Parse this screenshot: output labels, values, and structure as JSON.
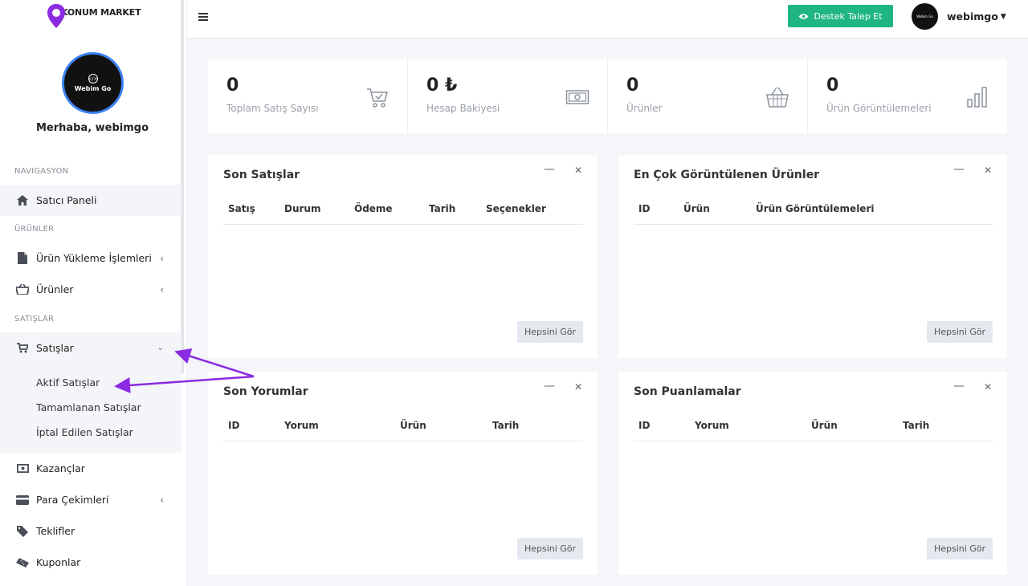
{
  "brand": {
    "name": "KONUM MARKET",
    "avatar_text": "Webim Go"
  },
  "sidebar": {
    "greeting": "Merhaba, webimgo",
    "sections": {
      "nav": "NAVIGASYON",
      "products": "ÜRÜNLER",
      "sales": "SATIŞLAR"
    },
    "items": {
      "dashboard": "Satıcı Paneli",
      "upload": "Ürün Yükleme İşlemleri",
      "products": "Ürünler",
      "sales": "Satışlar",
      "earnings": "Kazançlar",
      "withdrawals": "Para Çekimleri",
      "offers": "Teklifler",
      "coupons": "Kuponlar"
    },
    "sales_sub": {
      "active": "Aktif Satışlar",
      "completed": "Tamamlanan Satışlar",
      "cancelled": "İptal Edilen Satışlar"
    }
  },
  "topbar": {
    "support_label": "Destek Talep Et",
    "username": "webimgo"
  },
  "stats": [
    {
      "value": "0",
      "label": "Toplam Satış Sayısı",
      "icon": "cart-check-icon"
    },
    {
      "value": "0 ₺",
      "label": "Hesap Bakiyesi",
      "icon": "money-icon"
    },
    {
      "value": "0",
      "label": "Ürünler",
      "icon": "basket-icon"
    },
    {
      "value": "0",
      "label": "Ürün Görüntülemeleri",
      "icon": "bar-chart-icon"
    }
  ],
  "cards": {
    "recent_sales": {
      "title": "Son Satışlar",
      "columns": [
        "Satış",
        "Durum",
        "Ödeme",
        "Tarih",
        "Seçenekler"
      ],
      "button": "Hepsini Gör"
    },
    "most_viewed": {
      "title": "En Çok Görüntülenen Ürünler",
      "columns": [
        "ID",
        "Ürün",
        "Ürün Görüntülemeleri"
      ],
      "button": "Hepsini Gör"
    },
    "recent_comments": {
      "title": "Son Yorumlar",
      "columns": [
        "ID",
        "Yorum",
        "Ürün",
        "Tarih"
      ],
      "button": "Hepsini Gör"
    },
    "recent_ratings": {
      "title": "Son Puanlamalar",
      "columns": [
        "ID",
        "Yorum",
        "Ürün",
        "Tarih"
      ],
      "button": "Hepsini Gör"
    }
  },
  "colors": {
    "accent": "#1fb584",
    "arrow": "#8b2be2",
    "avatar_ring": "#3b82f6",
    "logo": "#8b2be2"
  }
}
